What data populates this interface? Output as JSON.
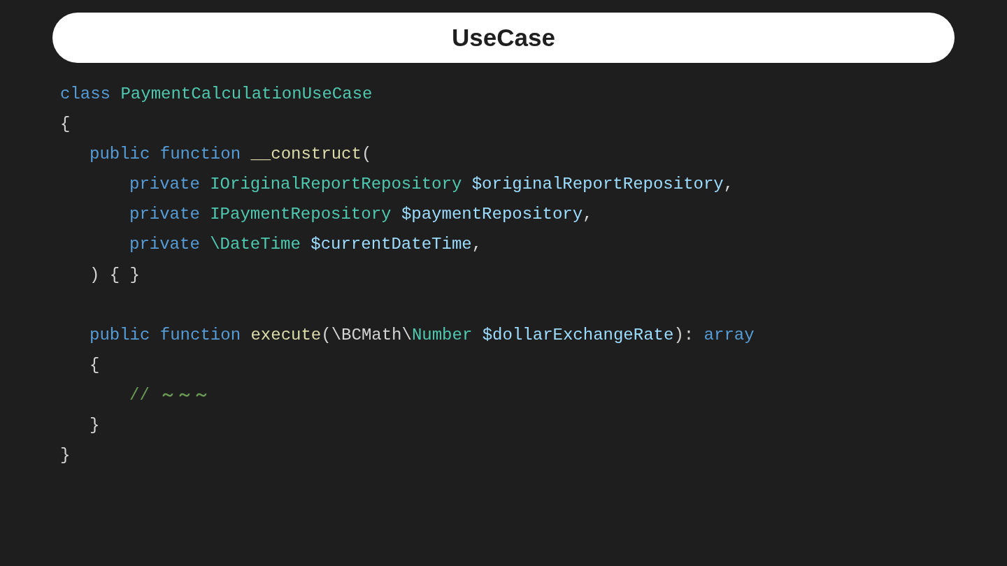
{
  "title": "UseCase",
  "code": {
    "lines": [
      {
        "kind": "code",
        "tokens": [
          {
            "kind": "keyword",
            "text": "class "
          },
          {
            "kind": "type",
            "text": "PaymentCalculationUseCase"
          }
        ]
      },
      {
        "kind": "code",
        "tokens": [
          {
            "kind": "plain",
            "text": "{"
          }
        ],
        "children": [
          {
            "kind": "code",
            "tokens": [
              {
                "kind": "keyword",
                "text": "public function "
              },
              {
                "kind": "function",
                "text": "__construct"
              },
              {
                "kind": "plain",
                "text": "("
              }
            ],
            "children": [
              {
                "kind": "code",
                "tokens": [
                  {
                    "kind": "keyword",
                    "text": "private "
                  },
                  {
                    "kind": "type",
                    "text": "IOriginalReportRepository "
                  },
                  {
                    "kind": "variable",
                    "text": "$originalReportRepository"
                  },
                  {
                    "kind": "plain",
                    "text": ","
                  }
                ]
              },
              {
                "kind": "code",
                "tokens": [
                  {
                    "kind": "keyword",
                    "text": "private "
                  },
                  {
                    "kind": "type",
                    "text": "IPaymentRepository "
                  },
                  {
                    "kind": "variable",
                    "text": "$paymentRepository"
                  },
                  {
                    "kind": "plain",
                    "text": ","
                  }
                ]
              },
              {
                "kind": "code",
                "tokens": [
                  {
                    "kind": "keyword",
                    "text": "private "
                  },
                  {
                    "kind": "type",
                    "text": "\\DateTime "
                  },
                  {
                    "kind": "variable",
                    "text": "$currentDateTime"
                  },
                  {
                    "kind": "plain",
                    "text": ","
                  }
                ]
              }
            ]
          },
          {
            "kind": "code",
            "tokens": [
              {
                "kind": "plain",
                "text": ") { }"
              }
            ]
          },
          {
            "kind": "blank"
          },
          {
            "kind": "code",
            "tokens": [
              {
                "kind": "keyword",
                "text": "public function "
              },
              {
                "kind": "function",
                "text": "execute"
              },
              {
                "kind": "plain",
                "text": "(\\BCMath\\"
              },
              {
                "kind": "type",
                "text": "Number "
              },
              {
                "kind": "variable",
                "text": "$dollarExchangeRate"
              },
              {
                "kind": "plain",
                "text": "): "
              },
              {
                "kind": "keyword",
                "text": "array"
              }
            ]
          },
          {
            "kind": "code",
            "tokens": [
              {
                "kind": "plain",
                "text": "{"
              }
            ],
            "children": [
              {
                "kind": "code",
                "tokens": [
                  {
                    "kind": "comment",
                    "text": "// "
                  },
                  {
                    "kind": "comment_strong",
                    "text": "～～～"
                  }
                ]
              }
            ]
          },
          {
            "kind": "code",
            "tokens": [
              {
                "kind": "plain",
                "text": "}"
              }
            ]
          }
        ]
      },
      {
        "kind": "code",
        "tokens": [
          {
            "kind": "plain",
            "text": "}"
          }
        ]
      }
    ]
  }
}
